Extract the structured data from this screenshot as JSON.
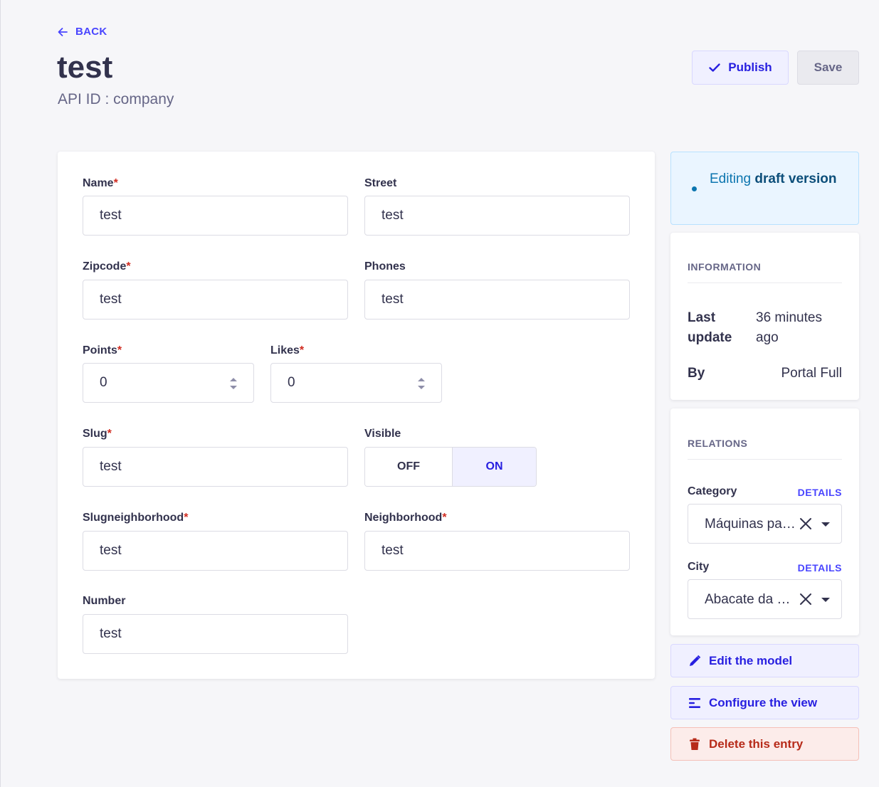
{
  "header": {
    "back_label": "BACK",
    "title": "test",
    "subtitle": "API ID : company",
    "publish_label": "Publish",
    "save_label": "Save"
  },
  "form": {
    "name": {
      "label": "Name",
      "required": true,
      "value": "test"
    },
    "street": {
      "label": "Street",
      "required": false,
      "value": "test"
    },
    "zipcode": {
      "label": "Zipcode",
      "required": true,
      "value": "test"
    },
    "phones": {
      "label": "Phones",
      "required": false,
      "value": "test"
    },
    "points": {
      "label": "Points",
      "required": true,
      "value": "0"
    },
    "likes": {
      "label": "Likes",
      "required": true,
      "value": "0"
    },
    "slug": {
      "label": "Slug",
      "required": true,
      "value": "test"
    },
    "visible": {
      "label": "Visible",
      "off_label": "OFF",
      "on_label": "ON",
      "selected": "ON"
    },
    "slugneighborhood": {
      "label": "Slugneighborhood",
      "required": true,
      "value": "test"
    },
    "neighborhood": {
      "label": "Neighborhood",
      "required": true,
      "value": "test"
    },
    "number": {
      "label": "Number",
      "required": false,
      "value": "test"
    }
  },
  "sidebar": {
    "status": {
      "prefix": "Editing ",
      "emphasis": "draft version"
    },
    "information": {
      "heading": "INFORMATION",
      "last_update_label_1": "Last",
      "last_update_label_2": "update",
      "last_update_value_1": "36 minutes",
      "last_update_value_2": "ago",
      "by_label": "By",
      "by_value": "Portal Full"
    },
    "relations": {
      "heading": "RELATIONS",
      "category": {
        "label": "Category",
        "link": "DETAILS",
        "value": "Máquinas par…"
      },
      "city": {
        "label": "City",
        "link": "DETAILS",
        "value": "Abacate da P…"
      }
    },
    "actions": {
      "edit_model": "Edit the model",
      "configure_view": "Configure the view",
      "delete_entry": "Delete this entry"
    }
  },
  "colors": {
    "primary": "#4945ff",
    "primary_dark": "#271fe0",
    "danger": "#d02b20",
    "info": "#0c75af"
  }
}
